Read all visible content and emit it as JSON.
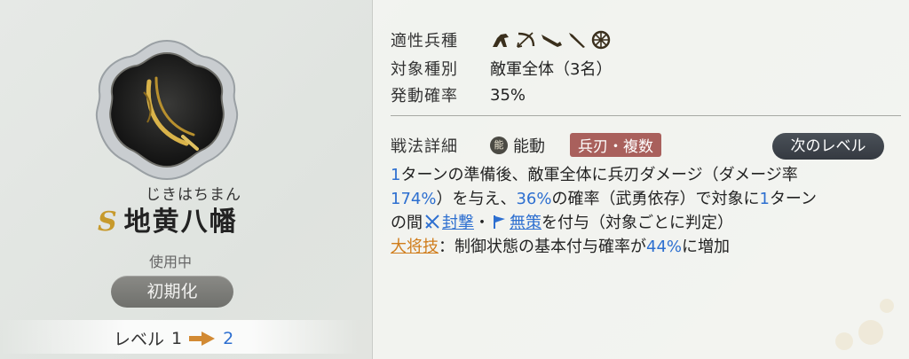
{
  "skill": {
    "furigana": "じきはちまん",
    "rank": "S",
    "name": "地黄八幡",
    "status": "使用中",
    "reset_label": "初期化",
    "level_label": "レベル",
    "level_current": "1",
    "level_next": "2"
  },
  "details": {
    "unit_label": "適性兵種",
    "unit_icons": [
      "cavalry-icon",
      "bow-icon",
      "gun-icon",
      "spear-icon",
      "shield-icon"
    ],
    "target_label": "対象種別",
    "target_value": "敵軍全体（3名）",
    "rate_label": "発動確率",
    "rate_value": "35%",
    "tactic_label": "戦法詳細",
    "tactic_kind_icon": "能",
    "tactic_kind": "能動",
    "tactic_tag": "兵刃・複数",
    "next_level_label": "次のレベル"
  },
  "description": {
    "l1_a": "1",
    "l1_b": "ターンの準備後、敵軍全体に兵刃ダメージ（ダメージ率",
    "l2_a": "174%",
    "l2_b": "）を与え、",
    "l2_c": "36%",
    "l2_d": "の確率（武勇依存）で対象に",
    "l2_e": "1",
    "l2_f": "ターン",
    "l3_a": "の間",
    "l3_seal": "封撃",
    "l3_dot": "・",
    "l3_nostrat": "無策",
    "l3_b": "を付与（対象ごとに判定）",
    "l4_general": "大将技",
    "l4_a": "：制御状態の基本付与確率が",
    "l4_b": "44%",
    "l4_c": "に増加"
  },
  "colors": {
    "accent_blue": "#2d6fd0",
    "tag_red": "#a9605c",
    "rank_gold": "#c79a2c",
    "general_orange": "#d07d1c"
  }
}
